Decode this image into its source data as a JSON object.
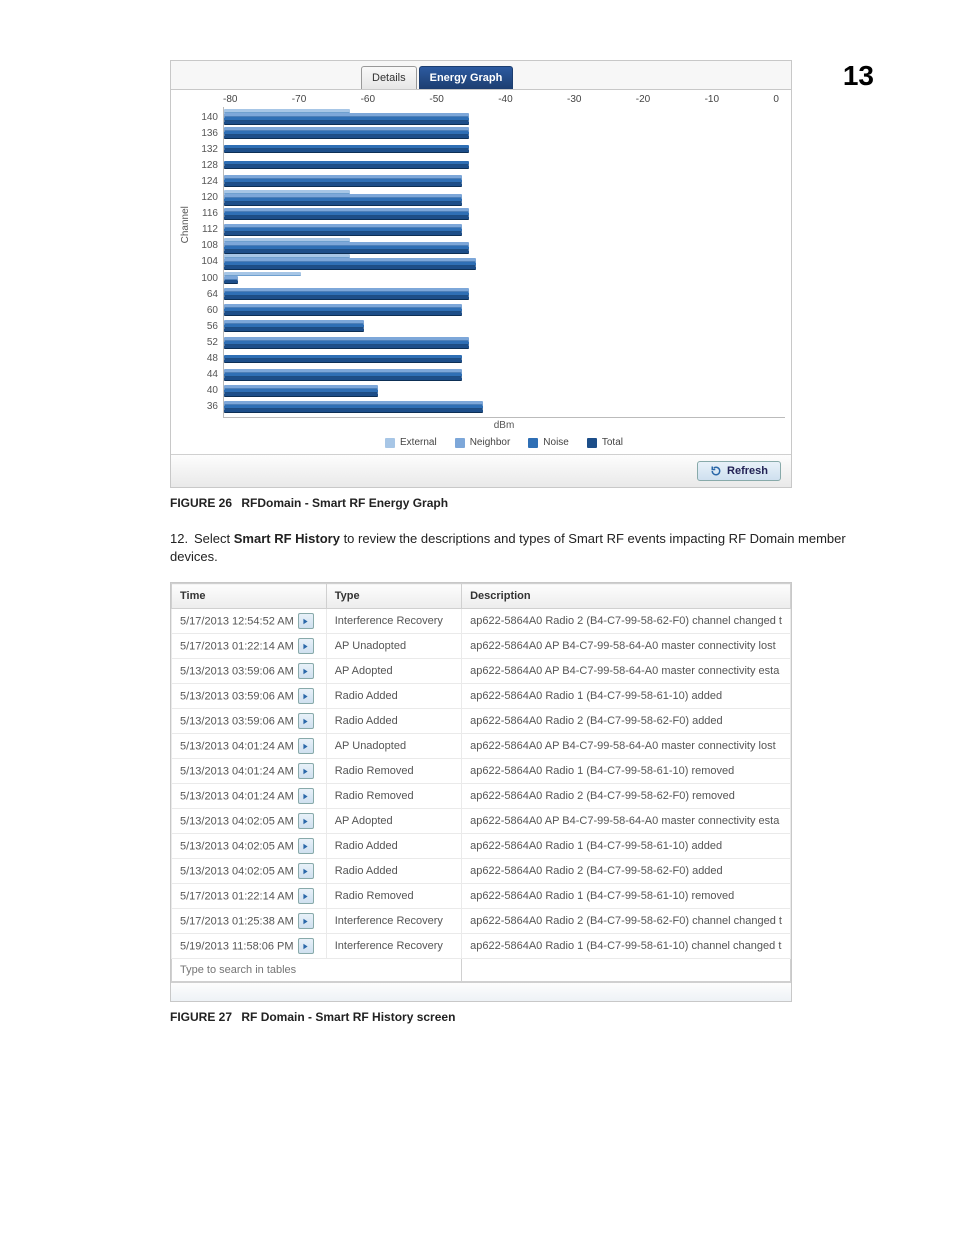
{
  "chapter_number": "13",
  "body_step": "12.",
  "body_prefix": "Select ",
  "body_bold": "Smart RF History",
  "body_suffix": " to review the descriptions and types of Smart RF events impacting RF Domain member devices.",
  "fig26": {
    "label": "FIGURE 26",
    "text": "RFDomain - Smart RF Energy Graph"
  },
  "fig27": {
    "label": "FIGURE 27",
    "text": "RF Domain - Smart RF History screen"
  },
  "tabs": {
    "details": "Details",
    "energy": "Energy Graph"
  },
  "refresh_label": "Refresh",
  "legend": {
    "external": "External",
    "neighbor": "Neighbor",
    "noise": "Noise",
    "total": "Total"
  },
  "ylabel": "Channel",
  "xunit": "dBm",
  "table": {
    "headers": {
      "time": "Time",
      "type": "Type",
      "desc": "Description"
    },
    "search_placeholder": "Type to search in tables",
    "rows": [
      {
        "time": "5/17/2013 12:54:52 AM",
        "type": "Interference Recovery",
        "desc": "ap622-5864A0 Radio 2 (B4-C7-99-58-62-F0) channel changed t"
      },
      {
        "time": "5/17/2013 01:22:14 AM",
        "type": "AP Unadopted",
        "desc": "ap622-5864A0 AP B4-C7-99-58-64-A0 master connectivity lost"
      },
      {
        "time": "5/13/2013 03:59:06 AM",
        "type": "AP Adopted",
        "desc": "ap622-5864A0 AP B4-C7-99-58-64-A0 master connectivity esta"
      },
      {
        "time": "5/13/2013 03:59:06 AM",
        "type": "Radio Added",
        "desc": "ap622-5864A0 Radio 1 (B4-C7-99-58-61-10) added"
      },
      {
        "time": "5/13/2013 03:59:06 AM",
        "type": "Radio Added",
        "desc": "ap622-5864A0 Radio 2 (B4-C7-99-58-62-F0) added"
      },
      {
        "time": "5/13/2013 04:01:24 AM",
        "type": "AP Unadopted",
        "desc": "ap622-5864A0 AP B4-C7-99-58-64-A0 master connectivity lost"
      },
      {
        "time": "5/13/2013 04:01:24 AM",
        "type": "Radio Removed",
        "desc": "ap622-5864A0 Radio 1 (B4-C7-99-58-61-10) removed"
      },
      {
        "time": "5/13/2013 04:01:24 AM",
        "type": "Radio Removed",
        "desc": "ap622-5864A0 Radio 2 (B4-C7-99-58-62-F0) removed"
      },
      {
        "time": "5/13/2013 04:02:05 AM",
        "type": "AP Adopted",
        "desc": "ap622-5864A0 AP B4-C7-99-58-64-A0 master connectivity esta"
      },
      {
        "time": "5/13/2013 04:02:05 AM",
        "type": "Radio Added",
        "desc": "ap622-5864A0 Radio 1 (B4-C7-99-58-61-10) added"
      },
      {
        "time": "5/13/2013 04:02:05 AM",
        "type": "Radio Added",
        "desc": "ap622-5864A0 Radio 2 (B4-C7-99-58-62-F0) added"
      },
      {
        "time": "5/17/2013 01:22:14 AM",
        "type": "Radio Removed",
        "desc": "ap622-5864A0 Radio 1 (B4-C7-99-58-61-10) removed"
      },
      {
        "time": "5/17/2013 01:25:38 AM",
        "type": "Interference Recovery",
        "desc": "ap622-5864A0 Radio 2 (B4-C7-99-58-62-F0) channel changed t"
      },
      {
        "time": "5/19/2013 11:58:06 PM",
        "type": "Interference Recovery",
        "desc": "ap622-5864A0 Radio 1 (B4-C7-99-58-61-10) channel changed t"
      }
    ]
  },
  "chart_data": {
    "type": "bar",
    "orientation": "horizontal",
    "xlabel": "dBm",
    "ylabel": "Channel",
    "xlim": [
      -80,
      0
    ],
    "x_ticks": [
      "-80",
      "-70",
      "-60",
      "-50",
      "-40",
      "-30",
      "-20",
      "-10",
      "0"
    ],
    "categories": [
      140,
      136,
      132,
      128,
      124,
      120,
      116,
      112,
      108,
      104,
      100,
      64,
      60,
      56,
      52,
      48,
      44,
      40,
      36
    ],
    "series_names": [
      "External",
      "Neighbor",
      "Noise",
      "Total"
    ],
    "series": [
      {
        "name": "External",
        "values": [
          -62,
          null,
          null,
          null,
          null,
          -62,
          null,
          null,
          -62,
          -62,
          -69,
          null,
          null,
          null,
          null,
          null,
          null,
          null,
          null
        ]
      },
      {
        "name": "Neighbor",
        "values": [
          -45,
          -45,
          null,
          null,
          -46,
          -46,
          -45,
          -46,
          -45,
          -44,
          -78,
          -45,
          -46,
          -60,
          -45,
          null,
          -46,
          -58,
          -43
        ]
      },
      {
        "name": "Noise",
        "values": [
          -45,
          -45,
          -45,
          -45,
          -46,
          -46,
          -45,
          -46,
          -45,
          -44,
          null,
          -45,
          -46,
          -60,
          -45,
          -46,
          -46,
          -58,
          -43
        ]
      },
      {
        "name": "Total",
        "values": [
          -45,
          -45,
          -45,
          -45,
          -46,
          -46,
          -45,
          -46,
          -45,
          -44,
          -78,
          -45,
          -46,
          -60,
          -45,
          -46,
          -46,
          -58,
          -43
        ]
      }
    ],
    "legend": [
      "External",
      "Neighbor",
      "Noise",
      "Total"
    ]
  }
}
